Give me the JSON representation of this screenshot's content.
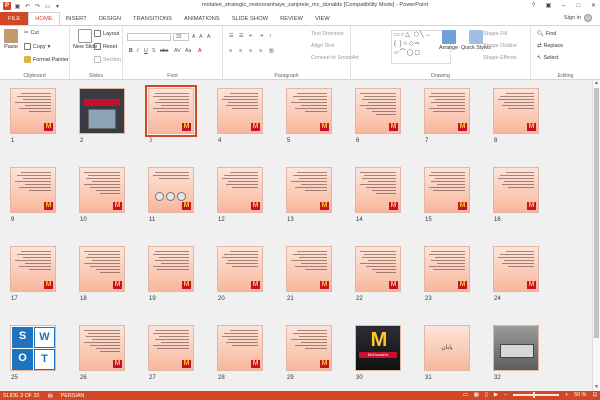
{
  "window": {
    "title": "motalee_strategic_restooranhaye_zanjireie_mc_donalds [Compatibility Mode] - PowerPoint",
    "help": "?",
    "signin": "Sign in"
  },
  "tabs": [
    "FILE",
    "HOME",
    "INSERT",
    "DESIGN",
    "TRANSITIONS",
    "ANIMATIONS",
    "SLIDE SHOW",
    "REVIEW",
    "VIEW"
  ],
  "ribbon": {
    "clipboard": {
      "paste": "Paste",
      "cut": "Cut",
      "copy": "Copy",
      "format_painter": "Format Painter",
      "label": "Clipboard"
    },
    "slides": {
      "new_slide": "New Slide",
      "layout": "Layout",
      "reset": "Reset",
      "section": "Section",
      "label": "Slides"
    },
    "font": {
      "font_size": "32",
      "label": "Font"
    },
    "paragraph": {
      "text_direction": "Text Direction",
      "align_text": "Align Text",
      "convert": "Convert to SmartArt",
      "label": "Paragraph"
    },
    "drawing": {
      "arrange": "Arrange",
      "quick_styles": "Quick Styles",
      "shape_fill": "Shape Fill",
      "shape_outline": "Shape Outline",
      "shape_effects": "Shape Effects",
      "label": "Drawing"
    },
    "editing": {
      "find": "Find",
      "replace": "Replace",
      "select": "Select",
      "label": "Editing"
    }
  },
  "slides": [
    {
      "n": "1",
      "kind": "text"
    },
    {
      "n": "2",
      "kind": "photo-store"
    },
    {
      "n": "3",
      "kind": "text",
      "selected": true
    },
    {
      "n": "4",
      "kind": "text"
    },
    {
      "n": "5",
      "kind": "text"
    },
    {
      "n": "6",
      "kind": "text"
    },
    {
      "n": "7",
      "kind": "text"
    },
    {
      "n": "8",
      "kind": "text"
    },
    {
      "n": "9",
      "kind": "text"
    },
    {
      "n": "10",
      "kind": "text"
    },
    {
      "n": "11",
      "kind": "pics"
    },
    {
      "n": "12",
      "kind": "text"
    },
    {
      "n": "13",
      "kind": "text"
    },
    {
      "n": "14",
      "kind": "text"
    },
    {
      "n": "15",
      "kind": "text"
    },
    {
      "n": "16",
      "kind": "text"
    },
    {
      "n": "17",
      "kind": "text"
    },
    {
      "n": "18",
      "kind": "text"
    },
    {
      "n": "19",
      "kind": "text"
    },
    {
      "n": "20",
      "kind": "text"
    },
    {
      "n": "21",
      "kind": "text"
    },
    {
      "n": "22",
      "kind": "text"
    },
    {
      "n": "23",
      "kind": "text"
    },
    {
      "n": "24",
      "kind": "text"
    },
    {
      "n": "25",
      "kind": "swot"
    },
    {
      "n": "26",
      "kind": "text"
    },
    {
      "n": "27",
      "kind": "text"
    },
    {
      "n": "28",
      "kind": "text"
    },
    {
      "n": "29",
      "kind": "text"
    },
    {
      "n": "30",
      "kind": "photo-dark"
    },
    {
      "n": "31",
      "kind": "end"
    },
    {
      "n": "32",
      "kind": "photo-grey"
    }
  ],
  "swot_letters": [
    "S",
    "W",
    "O",
    "T"
  ],
  "slide30_sign": "McDonald's",
  "slide31_text": "پایان",
  "status": {
    "slide": "SLIDE 3 OF 32",
    "language": "PERSIAN",
    "zoom": "50 %"
  },
  "colors": {
    "accent": "#d24726",
    "slide_bg": "#fbd1bf",
    "mcd_red": "#c8102e",
    "mcd_yellow": "#ffc72c"
  }
}
